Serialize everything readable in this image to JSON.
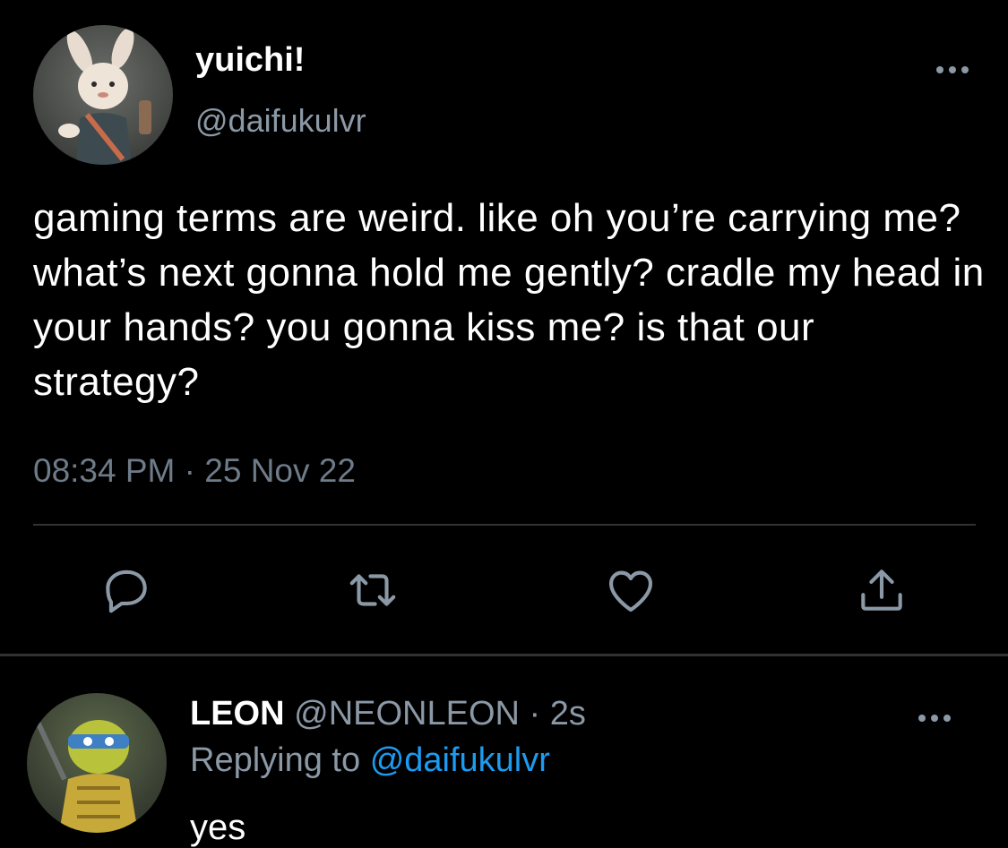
{
  "main_tweet": {
    "display_name": "yuichi!",
    "handle": "@daifukulvr",
    "text": "gaming terms are weird. like oh you’re carrying me? what’s next gonna hold me gently? cradle my head in your hands? you gonna kiss me? is that our strategy?",
    "time": "08:34 PM",
    "separator": "·",
    "date": "25 Nov 22",
    "avatar_icon": "user-avatar-rabbit-character",
    "more_icon": "more-options-icon",
    "actions": {
      "reply_icon": "reply-icon",
      "retweet_icon": "retweet-icon",
      "like_icon": "heart-icon",
      "share_icon": "share-icon"
    }
  },
  "reply_tweet": {
    "display_name": "LEON",
    "handle": "@NEONLEON",
    "separator": "·",
    "time_ago": "2s",
    "replying_prefix": "Replying to",
    "replying_to": "@daifukulvr",
    "text": "yes",
    "avatar_icon": "user-avatar-turtle-character",
    "more_icon": "more-options-icon"
  },
  "colors": {
    "background": "#000000",
    "primary_text": "#ffffff",
    "secondary_text": "#8b98a5",
    "link": "#1d9bf0",
    "divider": "#2f3336"
  }
}
